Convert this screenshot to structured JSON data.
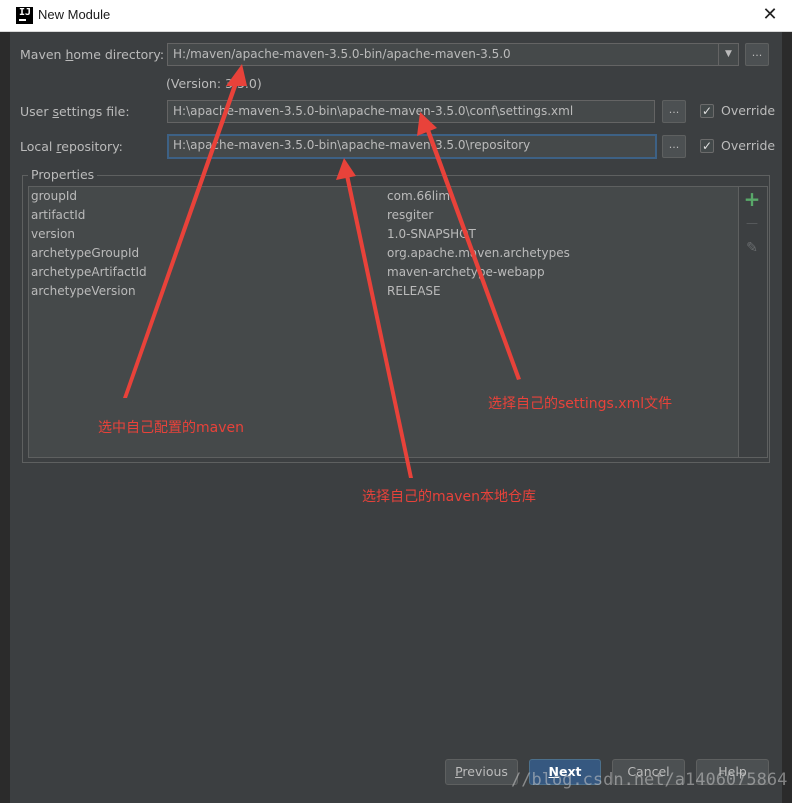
{
  "window": {
    "title": "New Module",
    "close_glyph": "✕",
    "icon_label": "IJ"
  },
  "form": {
    "maven_home": {
      "label_pre": "Maven ",
      "label_mnemonic": "h",
      "label_post": "ome directory:",
      "value": "H:/maven/apache-maven-3.5.0-bin/apache-maven-3.5.0",
      "version": "(Version: 3.5.0)"
    },
    "user_settings": {
      "label_pre": "User ",
      "label_mnemonic": "s",
      "label_post": "ettings file:",
      "value": "H:\\apache-maven-3.5.0-bin\\apache-maven-3.5.0\\conf\\settings.xml",
      "override_label": "Override",
      "override_checked": true
    },
    "local_repo": {
      "label_pre": "Local ",
      "label_mnemonic": "r",
      "label_post": "epository:",
      "value": "H:\\apache-maven-3.5.0-bin\\apache-maven-3.5.0\\repository",
      "override_label": "Override",
      "override_checked": true
    },
    "browse_label": "..."
  },
  "properties": {
    "title": "Properties",
    "rows": [
      {
        "key": "groupId",
        "value": "com.66lim"
      },
      {
        "key": "artifactId",
        "value": "resgiter"
      },
      {
        "key": "version",
        "value": "1.0-SNAPSHOT"
      },
      {
        "key": "archetypeGroupId",
        "value": "org.apache.maven.archetypes"
      },
      {
        "key": "archetypeArtifactId",
        "value": "maven-archetype-webapp"
      },
      {
        "key": "archetypeVersion",
        "value": "RELEASE"
      }
    ],
    "toolbar": {
      "add_glyph": "+",
      "remove_glyph": "—",
      "edit_glyph": "✎"
    }
  },
  "annotations": {
    "maven": "选中自己配置的maven",
    "settings": "选择自己的settings.xml文件",
    "repository": "选择自己的maven本地仓库"
  },
  "buttons": {
    "previous_mnemonic": "P",
    "previous_rest": "revious",
    "next_mnemonic": "N",
    "next_rest": "ext",
    "cancel": "Cancel",
    "help": "Help"
  },
  "watermark": "//blog.csdn.net/a1406075864",
  "colors": {
    "annotation": "#e8423a",
    "primary_button": "#365880",
    "dialog_bg": "#3c3f41",
    "add_icon": "#59a869"
  }
}
